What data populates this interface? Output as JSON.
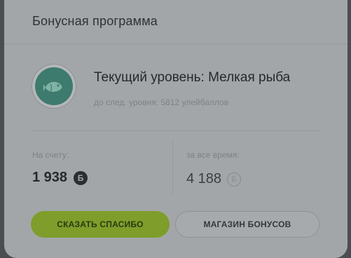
{
  "card": {
    "title": "Бонусная программа"
  },
  "level": {
    "title": "Текущий уровень: Мелкая рыба",
    "next_level_text": "до след. уровня: 5812 улейбаллов",
    "icon": "fish-icon",
    "icon_color": "#3d7b6e"
  },
  "stats": {
    "account_label": "На счету:",
    "account_value": "1 938",
    "all_time_label": "за все время:",
    "all_time_value": "4 188",
    "coin_symbol": "Б"
  },
  "buttons": {
    "thanks_label": "СКАЗАТЬ СПАСИБО",
    "shop_label": "МАГАЗИН БОНУСОВ",
    "accent_color": "#7e9d2a"
  }
}
